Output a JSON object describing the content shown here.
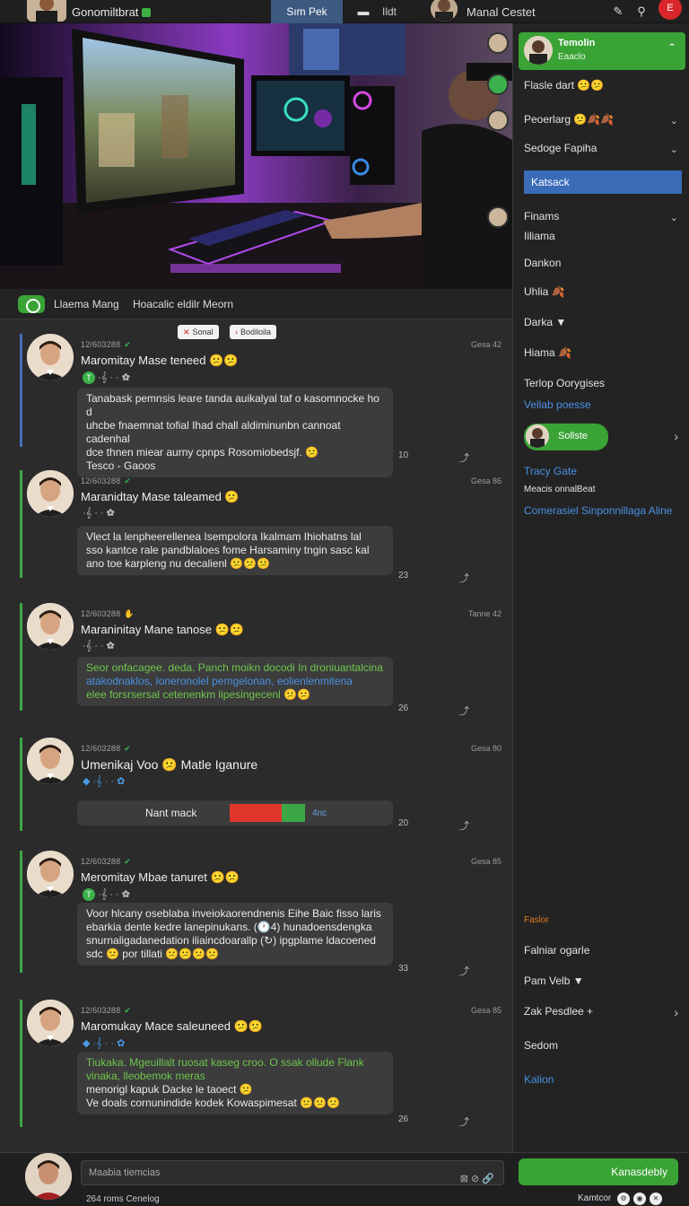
{
  "topbar": {
    "app_name": "Gonomiltbrat",
    "tab": "Sım Pek",
    "mid_label": "Ildt",
    "user_name": "Manal Cestet",
    "badge": "E"
  },
  "chat_header": {
    "name": "Llaema Mang",
    "subtitle": "Hoacalic eldilr  Meorn"
  },
  "pills": [
    {
      "mark": "✕",
      "label": "Sonal"
    },
    {
      "mark": "›",
      "label": "Bodiloila"
    }
  ],
  "messages": [
    {
      "meta": "12/603288",
      "time": "Gesa 42",
      "name": "Maromitay Mase teneed 😕😕",
      "reacts": "·𝄞 · ·  ✿",
      "lines": [
        "Tanabask pemnsis leare tanda auikalyal taf o kasomnocke ho d",
        "uhcbe fnaemnat tofial Ihad chall aldiminunbn cannoat cadenhal",
        "dce thnen miear aurny cpnps Rosomiobedsjf. 😕",
        "Tesco - Gaoos"
      ],
      "count": "10",
      "share": "⤴"
    },
    {
      "meta": "12/603288",
      "time": "Gesa 86",
      "name": "Maranidtay Mase taleamed 😕",
      "reacts": "·𝄞 · ·  ✿",
      "lines": [
        "Vlect la lenpheerellenea Isempolora Ikalmam Ihiohatns lal",
        "sso kantce rale pandblaloes fome Harsaminy tngin sasc kal",
        "ano toe karpleng nu decalienl 😕😕😕"
      ],
      "count": "23",
      "share": "⤴"
    },
    {
      "meta": "12/603288",
      "time": "Tanne 42",
      "name": "Maraninitay Mane tanose 😕😕",
      "reacts": "·𝄞 · ·  ✿",
      "lines": [
        "Seor onfacagee. deda. Panch moikn docodi In droniuantalcina",
        "atakodnaklos, Ioneronolel pemgelonan, eolienlenmitena",
        "elee forsrsersal cetenenkm lipesingecenl 😕😕"
      ],
      "count": "26",
      "share": "⤴"
    },
    {
      "meta": "12/603288",
      "time": "Gesa 80",
      "name": "Umenikaj Voo 😕 Matle Iganure",
      "reacts": "◆ ·𝄞 · ·  ✿",
      "mark_label": "Nant mack",
      "mark_tag": "4nc",
      "count": "20",
      "share": "⤴"
    },
    {
      "meta": "12/603288",
      "time": "Gesa 85",
      "name": "Meromitay Mbae tanuret 😕😕",
      "reacts": "·𝄞 · ·  ✿",
      "lines": [
        "Voor hlcany oseblaba inveiokaorendnenis Eihe Baic fisso laris",
        "ebarkia dente kedre lanepinukans. (🕐4) hunadoensdengka",
        "snurnaligadanedation iliaincdoarallp (↻) ipgplame ldacoened",
        "sdc 😕 por tillati 😕😕😕😕"
      ],
      "count": "33",
      "share": "⤴"
    },
    {
      "meta": "12/603288",
      "time": "Gesa 85",
      "name": "Maromukay Mace saleuneed 😕😕",
      "reacts": "◆ ·𝄞 · ·  ✿",
      "lines": [
        "Tiukaka. Mgeuillalt ruosat kaseg croo. O ssak ollude Flank",
        "vinaka, lleobemok meras",
        "menorigl kapuk Dacke le taoect 😕",
        "Ve doals cornunindide kodek Kowaspimesat 😕😕😕"
      ],
      "count": "26",
      "share": "⤴"
    }
  ],
  "composer": {
    "placeholder": "Maabia tiemcias",
    "tools": "⊠ ⊘  🔗",
    "send_label": "Kanasdebly",
    "footer_left": "264 roms Cenelog",
    "footer_right": "Kamtcor"
  },
  "sidebar": {
    "profile_name": "Temolin",
    "profile_sub": "Eaaclo",
    "items": [
      {
        "label": "Flasle dart 😕😕"
      },
      {
        "label": "Peoerlarg 😕🍂🍂"
      },
      {
        "label": "Sedoge Fapiha"
      },
      {
        "label": "Katsack"
      },
      {
        "label": "Finams"
      },
      {
        "label": "Iiliama"
      },
      {
        "label": "Dankon"
      },
      {
        "label": "Uhlia 🍂"
      },
      {
        "label": "Darka ▼"
      },
      {
        "label": "Hiama 🍂"
      },
      {
        "label": "Terlop Oorygises"
      },
      {
        "label": "Vellab poesse"
      },
      {
        "label": "Sollste"
      },
      {
        "label": "Tracy Gate"
      },
      {
        "label": "Meacis onnalBeat"
      },
      {
        "label": "Comerasiel Sinponnillaga Aline"
      },
      {
        "label": "Faslor"
      },
      {
        "label": "Falniar ogarle"
      },
      {
        "label": "Pam Velb ▼"
      },
      {
        "label": "Zak Pesdlee +"
      },
      {
        "label": "Sedom"
      },
      {
        "label": "Kalion"
      }
    ]
  }
}
